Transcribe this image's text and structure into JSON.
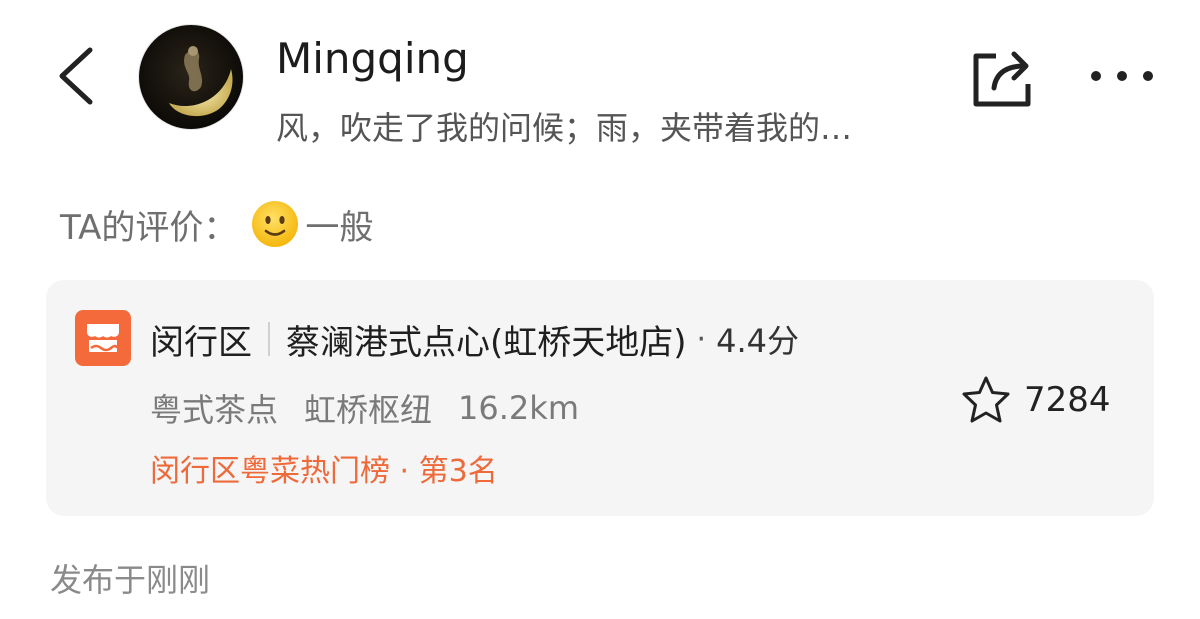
{
  "header": {
    "username": "Mingqing",
    "bio": "风，吹走了我的问候；雨，夹带着我的…",
    "back_icon": "chevron-left-icon",
    "share_icon": "share-icon",
    "more_icon": "more-dots-icon"
  },
  "rating": {
    "label": "TA的评价：",
    "emoji_icon": "slight-smile-icon",
    "value": "一般"
  },
  "shop_card": {
    "icon": "shop-icon",
    "icon_color": "#F46A3B",
    "district": "闵行区",
    "name": "蔡澜港式点心(虹桥天地店)",
    "separator_dot": "·",
    "score": "4.4分",
    "tags": [
      "粤式茶点",
      "虹桥枢纽",
      "16.2km"
    ],
    "rank_text": "闵行区粤菜热门榜 · 第3名",
    "rank_color": "#EE6A3A",
    "favorite_icon": "star-outline-icon",
    "favorite_count": "7284"
  },
  "footer": {
    "posted_time": "发布于刚刚"
  }
}
